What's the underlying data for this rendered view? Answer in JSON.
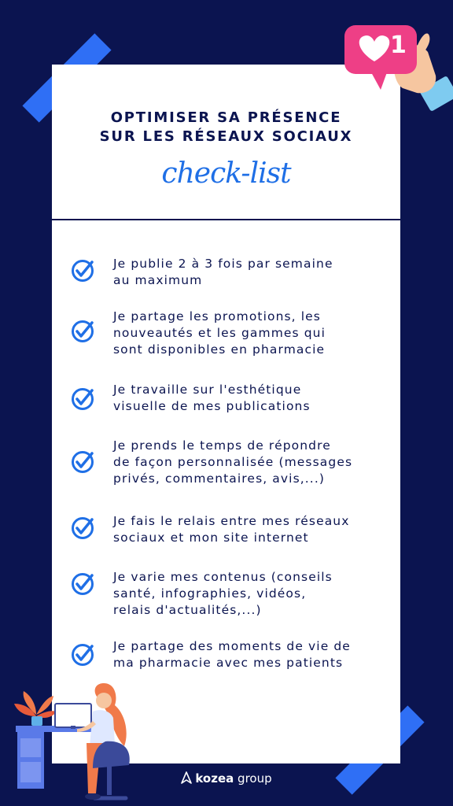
{
  "header": {
    "title_line1": "OPTIMISER SA PRÉSENCE",
    "title_line2": "SUR LES RÉSEAUX SOCIAUX",
    "subtitle": "check-list"
  },
  "checklist": [
    {
      "line1": "Je publie 2 à 3 fois par semaine",
      "line2": "au maximum",
      "line3": ""
    },
    {
      "line1": "Je partage les promotions, les",
      "line2": "nouveautés et les gammes qui",
      "line3": "sont disponibles en pharmacie"
    },
    {
      "line1": "Je travaille sur l'esthétique",
      "line2": "visuelle de mes publications",
      "line3": ""
    },
    {
      "line1": "Je prends le temps de répondre",
      "line2": "de façon personnalisée (messages",
      "line3": "privés, commentaires, avis,...)"
    },
    {
      "line1": "Je fais le relais entre mes réseaux",
      "line2": "sociaux et mon site internet",
      "line3": ""
    },
    {
      "line1": "Je varie mes contenus (conseils",
      "line2": "santé, infographies, vidéos,",
      "line3": "relais d'actualités,...)"
    },
    {
      "line1": "Je partage des moments de vie de",
      "line2": "ma pharmacie avec mes patients",
      "line3": ""
    }
  ],
  "badge": {
    "count": "1"
  },
  "footer": {
    "brand": "kozea",
    "suffix": "group"
  },
  "colors": {
    "navy": "#0b1450",
    "blue": "#1f6fe6",
    "pink": "#ee3f86"
  }
}
